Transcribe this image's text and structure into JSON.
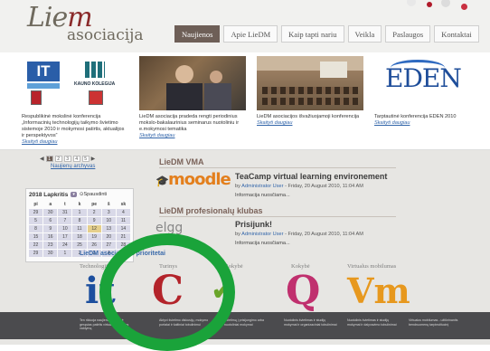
{
  "header": {
    "logo_script": "Lie",
    "logo_script_m": "m",
    "logo_sub": "asociacija",
    "nav": [
      "Naujienos",
      "Apie LieDM",
      "Kaip tapti nariu",
      "Veikla",
      "Paslaugos",
      "Kontaktai"
    ],
    "active_nav": 0
  },
  "features": [
    {
      "text": "Respublikinė mokslinė konferencija „Informacinių technologijų taikymo švietimo sistemoje 2010 ir mokymosi patirtis, aktualijos ir perspektyvos“",
      "link": "Skaityti daugiau",
      "img_labels": [
        "IT",
        "KAUNO KOLEGIJA"
      ]
    },
    {
      "text": "LieDM asociacija pradeda rengti periodinius mokslo-bakalaurinius seminarus nuotoliniu ir e.mokymosi tematika",
      "link": "Skaityti daugiau"
    },
    {
      "text": "LieDM asociacijos išvažiuojamoji konferencija",
      "link": "Skaityti daugiau"
    },
    {
      "text": "Tarptautinė konferencija EDEN 2010",
      "link": "Skaityti daugiau",
      "img_labels": [
        "EDEN"
      ]
    }
  ],
  "pager": {
    "pages": [
      "1",
      "2",
      "3",
      "4",
      "5"
    ],
    "active": 0,
    "archive": "Naujienų archyvas"
  },
  "calendar": {
    "year_month": "2018 Lapkritis",
    "print": "Spausdinti",
    "days": [
      "pi",
      "a",
      "t",
      "k",
      "pe",
      "š",
      "sk"
    ],
    "rows": [
      [
        "29",
        "30",
        "31",
        "1",
        "2",
        "3",
        "4"
      ],
      [
        "5",
        "6",
        "7",
        "8",
        "9",
        "10",
        "11"
      ],
      [
        "8",
        "9",
        "10",
        "11",
        "12",
        "13",
        "14"
      ],
      [
        "15",
        "16",
        "17",
        "18",
        "19",
        "20",
        "21"
      ],
      [
        "22",
        "23",
        "24",
        "25",
        "26",
        "27",
        "28"
      ],
      [
        "29",
        "30",
        "1",
        "2",
        "3",
        "4",
        "5"
      ]
    ],
    "today_row": 2,
    "today_col": 4
  },
  "vma": {
    "section": "LieDM VMA",
    "logo": "moodle",
    "post_title": "TeaCamp virtual learning environement",
    "meta_by": "by",
    "author": "Administrator User",
    "meta_date": "- Friday, 20 August 2010, 11:04 AM",
    "more": "Informacija nuosčiama..."
  },
  "club": {
    "section": "LieDM profesionalų klubas",
    "logo": "elgg",
    "post_title": "Prisijunk!",
    "meta_by": "by",
    "author": "Administrator User",
    "meta_date": "- Friday, 20 August 2010, 11:04 AM",
    "more": "Informacija nuosčiama..."
  },
  "priorities": {
    "title": "LieDM asociacijos prioritetai",
    "labels": [
      "Technologijos",
      "Turinys",
      "Kokybė",
      "Kokybė",
      "Virtualus mobilumas"
    ],
    "icons": [
      "it",
      "C",
      "check",
      "Q",
      "Vm"
    ]
  },
  "footer": {
    "cols": [
      "Ten rikiuoja naujienas, veiklą ir gerąsias patirtis virtualų priežiūros valdymą",
      "Aktyvi švietimo diskusijų, mokymo portalai ir šaltiniai tobulinimui",
      "Kvietimą į prisijungimo arba nuotoliniai mokymai",
      "Nuotolinis švietimas ir studijų mokymai ir organizaciniai tobulinimai",
      "Nuotolinis švietimas ir studijų mokymai ir dalyvavimo tobulinimai",
      "Virtualus mobilumas - užtikrinantis bendruomenę tarpinstitucinį"
    ]
  },
  "colors": {
    "accent": "#6e5f57",
    "ring": "#1aa33a",
    "link": "#3366aa"
  }
}
